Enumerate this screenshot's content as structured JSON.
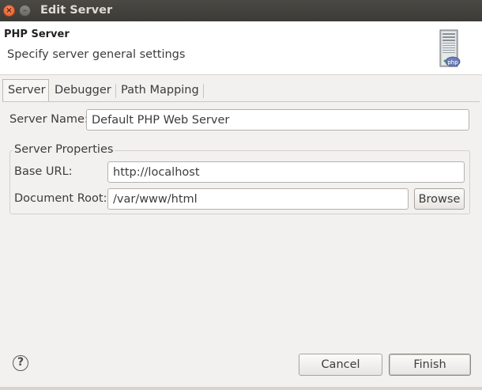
{
  "window": {
    "title": "Edit Server",
    "close_glyph": "×",
    "minimize_glyph": "–"
  },
  "header": {
    "title": "PHP Server",
    "description": "Specify server general settings",
    "icon": "php-server-icon",
    "icon_badge": "php"
  },
  "tabs": [
    {
      "label": "Server",
      "selected": true
    },
    {
      "label": "Debugger",
      "selected": false
    },
    {
      "label": "Path Mapping",
      "selected": false
    }
  ],
  "form": {
    "server_name_label": "Server Name:",
    "server_name_value": "Default PHP Web Server",
    "properties_group_title": "Server Properties",
    "base_url_label": "Base URL:",
    "base_url_value": "http://localhost",
    "document_root_label": "Document Root:",
    "document_root_value": "/var/www/html",
    "browse_label": "Browse"
  },
  "footer": {
    "help_glyph": "?",
    "cancel_label": "Cancel",
    "finish_label": "Finish"
  }
}
